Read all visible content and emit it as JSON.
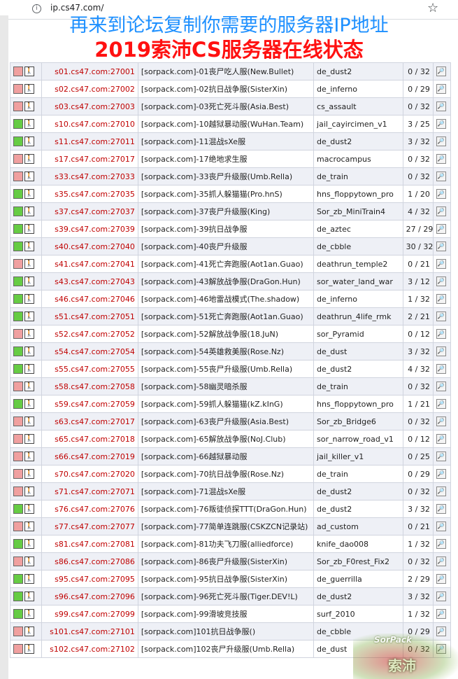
{
  "browser": {
    "url": "ip.cs47.com/"
  },
  "banner": {
    "line1": "再来到论坛复制你需要的服务器IP地址",
    "line2": "2019索沛CS服务器在线状态"
  },
  "colors": {
    "online": "#66cc44",
    "offline": "#f0a0a0",
    "address": "#c00000"
  },
  "servers": [
    {
      "status": "offline",
      "address": "s01.cs47.com:27001",
      "name": "[sorpack.com]-01丧尸吃人服(New.Bullet)",
      "map": "de_dust2",
      "players": "0 / 32"
    },
    {
      "status": "offline",
      "address": "s02.cs47.com:27002",
      "name": "[sorpack.com]-02抗日战争服(SisterXin)",
      "map": "de_inferno",
      "players": "0 / 29"
    },
    {
      "status": "offline",
      "address": "s03.cs47.com:27003",
      "name": "[sorpack.com]-03死亡死斗服(Asia.Best)",
      "map": "cs_assault",
      "players": "0 / 32"
    },
    {
      "status": "online",
      "address": "s10.cs47.com:27010",
      "name": "[sorpack.com]-10越狱暴动服(WuHan.Team)",
      "map": "jail_cayircimen_v1",
      "players": "3 / 25"
    },
    {
      "status": "online",
      "address": "s11.cs47.com:27011",
      "name": "[sorpack.com]-11混战sXe服",
      "map": "de_dust2",
      "players": "3 / 32"
    },
    {
      "status": "offline",
      "address": "s17.cs47.com:27017",
      "name": "[sorpack.com]-17绝地求生服",
      "map": "macrocampus",
      "players": "0 / 32"
    },
    {
      "status": "offline",
      "address": "s33.cs47.com:27033",
      "name": "[sorpack.com]-33丧尸升级服(Umb.Rella)",
      "map": "de_train",
      "players": "0 / 32"
    },
    {
      "status": "online",
      "address": "s35.cs47.com:27035",
      "name": "[sorpack.com]-35抓人躲猫猫(Pro.hnS)",
      "map": "hns_floppytown_pro",
      "players": "1 / 20"
    },
    {
      "status": "online",
      "address": "s37.cs47.com:27037",
      "name": "[sorpack.com]-37丧尸升级服(King)",
      "map": "Sor_zb_MiniTrain4",
      "players": "4 / 32"
    },
    {
      "status": "online",
      "address": "s39.cs47.com:27039",
      "name": "[sorpack.com]-39抗日战争服",
      "map": "de_aztec",
      "players": "27 / 29"
    },
    {
      "status": "online",
      "address": "s40.cs47.com:27040",
      "name": "[sorpack.com]-40丧尸升级服",
      "map": "de_cbble",
      "players": "30 / 32"
    },
    {
      "status": "offline",
      "address": "s41.cs47.com:27041",
      "name": "[sorpack.com]-41死亡奔跑服(Aot1an.Guao)",
      "map": "deathrun_temple2",
      "players": "0 / 21"
    },
    {
      "status": "online",
      "address": "s43.cs47.com:27043",
      "name": "[sorpack.com]-43解放战争服(DraGon.Hun)",
      "map": "sor_water_land_war",
      "players": "3 / 12"
    },
    {
      "status": "online",
      "address": "s46.cs47.com:27046",
      "name": "[sorpack.com]-46地雷战模式(The.shadow)",
      "map": "de_inferno",
      "players": "1 / 32"
    },
    {
      "status": "online",
      "address": "s51.cs47.com:27051",
      "name": "[sorpack.com]-51死亡奔跑服(Aot1an.Guao)",
      "map": "deathrun_4life_rmk",
      "players": "2 / 21"
    },
    {
      "status": "offline",
      "address": "s52.cs47.com:27052",
      "name": "[sorpack.com]-52解放战争服(18.JuN)",
      "map": "sor_Pyramid",
      "players": "0 / 12"
    },
    {
      "status": "online",
      "address": "s54.cs47.com:27054",
      "name": "[sorpack.com]-54英雄救美服(Rose.Nz)",
      "map": "de_dust",
      "players": "3 / 32"
    },
    {
      "status": "online",
      "address": "s55.cs47.com:27055",
      "name": "[sorpack.com]-55丧尸升级服(Umb.Rella)",
      "map": "de_dust2",
      "players": "4 / 32"
    },
    {
      "status": "offline",
      "address": "s58.cs47.com:27058",
      "name": "[sorpack.com]-58幽灵暗杀服",
      "map": "de_train",
      "players": "0 / 32"
    },
    {
      "status": "online",
      "address": "s59.cs47.com:27059",
      "name": "[sorpack.com]-59抓人躲猫猫(kZ.kInG)",
      "map": "hns_floppytown_pro",
      "players": "1 / 21"
    },
    {
      "status": "offline",
      "address": "s63.cs47.com:27017",
      "name": "[sorpack.com]-63丧尸升级服(Asia.Best)",
      "map": "Sor_zb_Bridge6",
      "players": "0 / 32"
    },
    {
      "status": "offline",
      "address": "s65.cs47.com:27018",
      "name": "[sorpack.com]-65解放战争服(NoJ.Club)",
      "map": "sor_narrow_road_v1",
      "players": "0 / 12"
    },
    {
      "status": "offline",
      "address": "s66.cs47.com:27019",
      "name": "[sorpack.com]-66越狱暴动服",
      "map": "jail_killer_v1",
      "players": "0 / 25"
    },
    {
      "status": "offline",
      "address": "s70.cs47.com:27020",
      "name": "[sorpack.com]-70抗日战争服(Rose.Nz)",
      "map": "de_train",
      "players": "0 / 29"
    },
    {
      "status": "offline",
      "address": "s71.cs47.com:27071",
      "name": "[sorpack.com]-71混战sXe服",
      "map": "de_dust2",
      "players": "0 / 32"
    },
    {
      "status": "online",
      "address": "s76.cs47.com:27076",
      "name": "[sorpack.com]-76叛徒侦探TTT(DraGon.Hun)",
      "map": "de_dust2",
      "players": "3 / 32"
    },
    {
      "status": "offline",
      "address": "s77.cs47.com:27077",
      "name": "[sorpack.com]-77简单连跳服(CSKZCN记录站)",
      "map": "ad_custom",
      "players": "0 / 21"
    },
    {
      "status": "online",
      "address": "s81.cs47.com:27081",
      "name": "[sorpack.com]-81功夫飞刀服(alliedforce)",
      "map": "knife_dao008",
      "players": "1 / 32"
    },
    {
      "status": "offline",
      "address": "s86.cs47.com:27086",
      "name": "[sorpack.com]-86丧尸升级服(SisterXin)",
      "map": "Sor_zb_F0rest_Fix2",
      "players": "0 / 32"
    },
    {
      "status": "online",
      "address": "s95.cs47.com:27095",
      "name": "[sorpack.com]-95抗日战争服(SisterXin)",
      "map": "de_guerrilla",
      "players": "2 / 29"
    },
    {
      "status": "online",
      "address": "s96.cs47.com:27096",
      "name": "[sorpack.com]-96死亡死斗服(Tiger.DEV!L)",
      "map": "de_dust2",
      "players": "3 / 32"
    },
    {
      "status": "online",
      "address": "s99.cs47.com:27099",
      "name": "[sorpack.com]-99滑坡竞技服",
      "map": "surf_2010",
      "players": "1 / 32"
    },
    {
      "status": "offline",
      "address": "s101.cs47.com:27101",
      "name": "[sorpack.com]101抗日战争服()",
      "map": "de_cbble",
      "players": "0 / 29"
    },
    {
      "status": "offline",
      "address": "s102.cs47.com:27102",
      "name": "[sorpack.com]102丧尸升级服(Umb.Rella)",
      "map": "de_dust",
      "players": "0 / 32"
    }
  ],
  "icons": {
    "player": "walking-man-icon",
    "details": "magnifier-icon",
    "info": "info-icon",
    "bookmark": "star-icon"
  },
  "watermark": {
    "line1": "SorPack",
    "line2": "索沛"
  }
}
